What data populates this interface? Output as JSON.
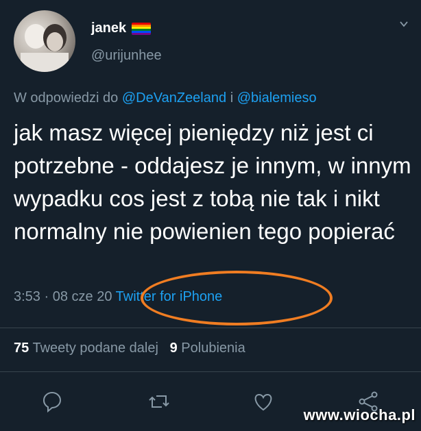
{
  "user": {
    "display_name": "janek",
    "handle": "@urijunhee",
    "flag_icon": "rainbow-flag-icon"
  },
  "reply": {
    "prefix": "W odpowiedzi do",
    "mention_1": "@DeVanZeeland",
    "conjunction": "i",
    "mention_2": "@bialemieso"
  },
  "tweet": {
    "text": "jak masz więcej pieniędzy niż jest ci potrzebne - oddajesz je innym, w innym wypadku cos jest z tobą nie tak i nikt normalny nie powienien tego popierać",
    "time": "3:53",
    "separator": "·",
    "date": "08 cze 20",
    "source": "Twitter for iPhone"
  },
  "stats": {
    "retweets_count": "75",
    "retweets_label": "Tweety podane dalej",
    "likes_count": "9",
    "likes_label": "Polubienia"
  },
  "actions": [
    "reply-icon",
    "retweet-icon",
    "like-icon",
    "share-icon"
  ],
  "watermark": "www.wiocha.pl",
  "colors": {
    "background": "#15202b",
    "link": "#1da1f2",
    "secondary_text": "#8899a6",
    "highlight_oval": "#f07d22"
  }
}
